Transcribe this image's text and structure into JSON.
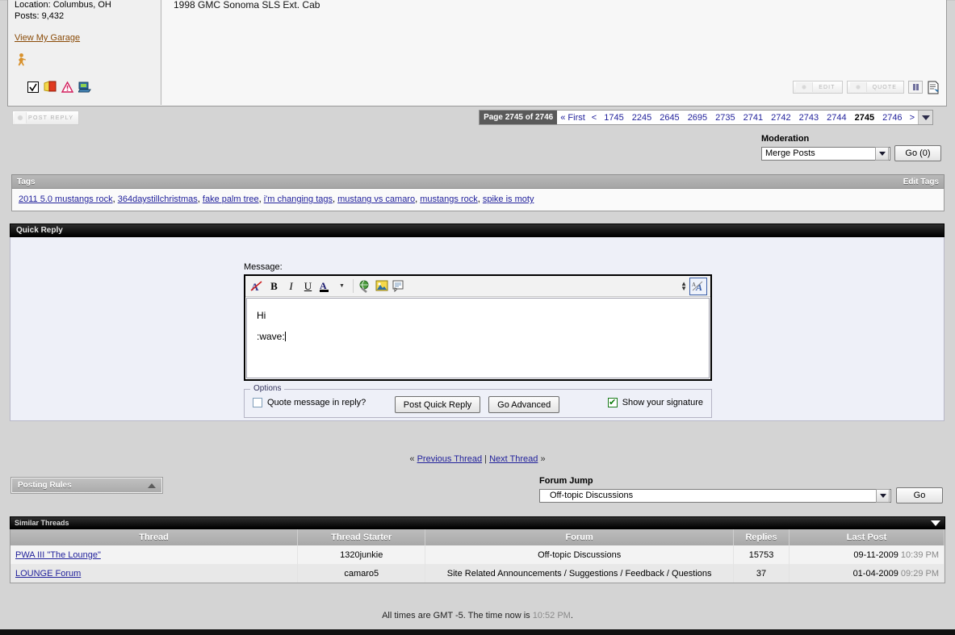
{
  "post": {
    "location_label": "Location: Columbus, OH",
    "posts_label": "Posts: 9,432",
    "garage_link": "View My Garage",
    "signature": "1998 GMC Sonoma SLS Ext. Cab",
    "buttons": {
      "edit": "EDIT",
      "quote": "QUOTE"
    },
    "icons": [
      "running-man-smiley",
      "checkbox-icon",
      "card-icon",
      "warning-triangle-icon",
      "send-message-icon",
      "multiquote-icon",
      "pause-icon"
    ]
  },
  "nav": {
    "post_reply_label": "POST REPLY",
    "page_label": "Page 2745 of 2746",
    "first": "« First",
    "prev": "<",
    "pages": [
      "1745",
      "2245",
      "2645",
      "2695",
      "2735",
      "2741",
      "2742",
      "2743",
      "2744",
      "2745",
      "2746"
    ],
    "current_page": "2745",
    "next": ">"
  },
  "moderation": {
    "title": "Moderation",
    "selected": "Merge Posts",
    "go_label": "Go (0)"
  },
  "tags": {
    "header": "Tags",
    "edit_label": "Edit Tags",
    "items": [
      "2011 5.0 mustangs rock",
      "364daystillchristmas",
      "fake palm tree",
      "i'm changing tags",
      "mustang vs camaro",
      "mustangs rock",
      "spike is moty"
    ]
  },
  "quick_reply": {
    "header": "Quick Reply",
    "message_label": "Message:",
    "message_line1": "Hi",
    "message_line2": ":wave:",
    "toolbar_icons": [
      "remove-formatting-icon",
      "bold-icon",
      "italic-icon",
      "underline-icon",
      "font-color-icon",
      "insert-link-icon",
      "insert-image-icon",
      "insert-quote-icon",
      "increase-decrease-size-icon",
      "toggle-editor-icon"
    ],
    "toolbar": {
      "bold": "B",
      "italic": "I",
      "underline": "U",
      "color": "A"
    },
    "options_legend": "Options",
    "quote_label": "Quote message in reply?",
    "quote_checked": false,
    "signature_label": "Show your signature",
    "signature_checked": true,
    "post_button": "Post Quick Reply",
    "advanced_button": "Go Advanced"
  },
  "thread_nav": {
    "prev_sym": "«",
    "prev": "Previous Thread",
    "divider": "|",
    "next": "Next Thread",
    "next_sym": "»"
  },
  "posting_rules": {
    "title": "Posting Rules"
  },
  "forum_jump": {
    "title": "Forum Jump",
    "selected": "Off-topic Discussions",
    "go_label": "Go"
  },
  "similar_threads": {
    "header": "Similar Threads",
    "columns": [
      "Thread",
      "Thread Starter",
      "Forum",
      "Replies",
      "Last Post"
    ],
    "rows": [
      {
        "thread": "PWA III \"The Lounge\"",
        "starter": "1320junkie",
        "forum": "Off-topic Discussions",
        "replies": "15753",
        "last_post_date": "09-11-2009",
        "last_post_time": "10:39 PM"
      },
      {
        "thread": "LOUNGE Forum",
        "starter": "camaro5",
        "forum": "Site Related Announcements / Suggestions / Feedback / Questions",
        "replies": "37",
        "last_post_date": "01-04-2009",
        "last_post_time": "09:29 PM"
      }
    ]
  },
  "footer": {
    "text_before": "All times are GMT -5. The time now is",
    "time": "10:52 PM",
    "text_after": "."
  }
}
